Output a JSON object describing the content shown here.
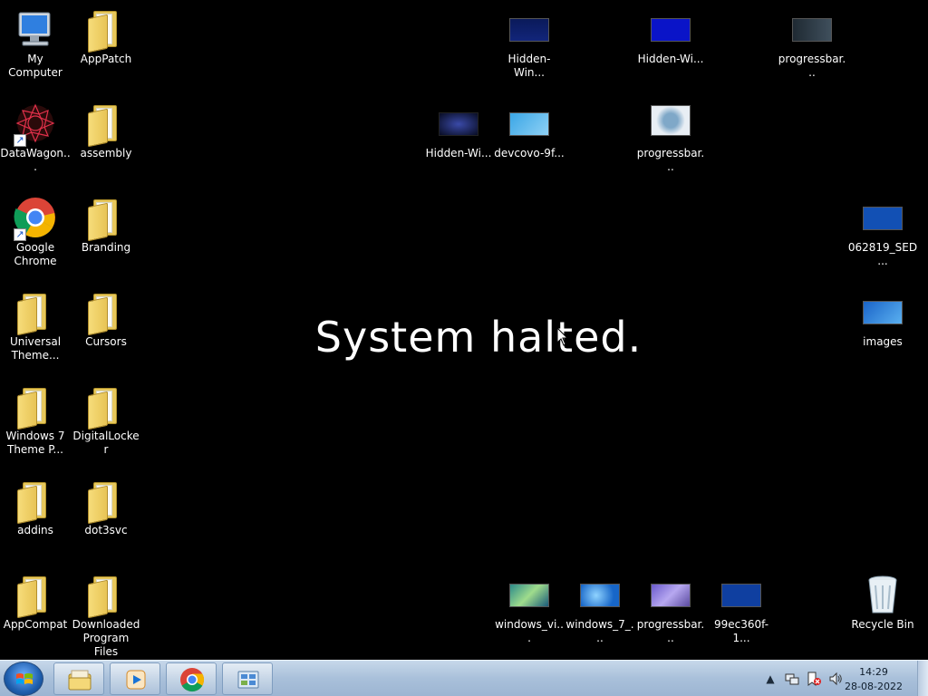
{
  "desktop": {
    "halt_message": "System halted.",
    "icons": [
      {
        "label": "My Computer",
        "kind": "computer-icon"
      },
      {
        "label": "AppPatch",
        "kind": "folder-icon"
      },
      {
        "label": "DataWagon...",
        "kind": "datawagon-icon"
      },
      {
        "label": "assembly",
        "kind": "folder-icon"
      },
      {
        "label": "Google Chrome",
        "kind": "chrome-icon"
      },
      {
        "label": "Branding",
        "kind": "folder-icon"
      },
      {
        "label": "Universal Theme...",
        "kind": "folder-icon"
      },
      {
        "label": "Cursors",
        "kind": "folder-icon"
      },
      {
        "label": "Windows 7 Theme P...",
        "kind": "folder-icon"
      },
      {
        "label": "DigitalLocker",
        "kind": "folder-icon"
      },
      {
        "label": "addins",
        "kind": "folder-icon"
      },
      {
        "label": "dot3svc",
        "kind": "folder-icon"
      },
      {
        "label": "AppCompat",
        "kind": "folder-icon"
      },
      {
        "label": "Downloaded Program Files",
        "kind": "folder-icon"
      },
      {
        "label": "Hidden-Win...",
        "kind": "image-thumbnail-icon"
      },
      {
        "label": "Hidden-Wi...",
        "kind": "image-thumbnail-icon"
      },
      {
        "label": "progressbar...",
        "kind": "image-thumbnail-icon"
      },
      {
        "label": "Hidden-Wi...",
        "kind": "image-thumbnail-icon"
      },
      {
        "label": "devcovo-9f...",
        "kind": "image-thumbnail-icon"
      },
      {
        "label": "progressbar...",
        "kind": "image-thumbnail-icon"
      },
      {
        "label": "062819_SED...",
        "kind": "image-thumbnail-icon"
      },
      {
        "label": "images",
        "kind": "image-thumbnail-icon"
      },
      {
        "label": "windows_vi...",
        "kind": "image-thumbnail-icon"
      },
      {
        "label": "windows_7_...",
        "kind": "image-thumbnail-icon"
      },
      {
        "label": "progressbar...",
        "kind": "image-thumbnail-icon"
      },
      {
        "label": "99ec360f-1...",
        "kind": "image-thumbnail-icon"
      },
      {
        "label": "Recycle Bin",
        "kind": "recycle-bin-icon"
      }
    ]
  },
  "taskbar": {
    "start_icon": "windows-start-orb-icon",
    "pinned": [
      {
        "name": "file-explorer-icon"
      },
      {
        "name": "media-player-icon"
      },
      {
        "name": "chrome-icon"
      },
      {
        "name": "control-panel-icon"
      }
    ],
    "tray": {
      "icons": [
        "show-hidden-icons-chevron",
        "network-icon",
        "action-center-icon",
        "volume-icon"
      ],
      "time": "14:29",
      "date": "28-08-2022"
    }
  }
}
